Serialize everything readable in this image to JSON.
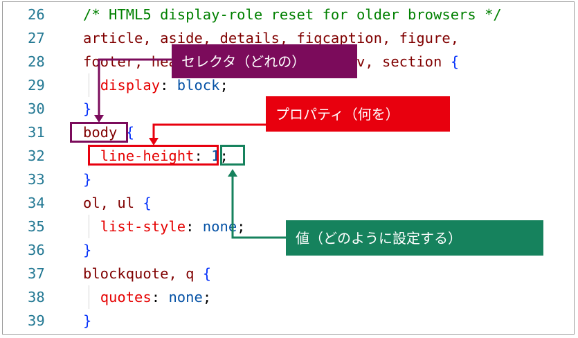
{
  "code": {
    "lines": [
      {
        "num": "26",
        "parts": [
          [
            "c-comment",
            "/* HTML5 display-role reset for older browsers */"
          ]
        ]
      },
      {
        "num": "27",
        "parts": [
          [
            "c-sel",
            "article, aside, details, figcaption, figure,"
          ]
        ]
      },
      {
        "num": "28",
        "parts": [
          [
            "c-sel",
            "footer, header, hgroup, menu, "
          ],
          [
            "c-sel",
            "nav, section "
          ],
          [
            "c-brace",
            "{"
          ]
        ]
      },
      {
        "num": "29",
        "parts": [
          [
            "c-punc",
            "  "
          ],
          [
            "c-prop",
            "display"
          ],
          [
            "c-punc",
            ": "
          ],
          [
            "c-val",
            "block"
          ],
          [
            "c-punc",
            ";"
          ]
        ]
      },
      {
        "num": "30",
        "parts": [
          [
            "c-brace",
            "}"
          ]
        ]
      },
      {
        "num": "31",
        "parts": [
          [
            "c-sel",
            "body"
          ],
          [
            "c-punc",
            " "
          ],
          [
            "c-brace",
            "{"
          ]
        ]
      },
      {
        "num": "32",
        "parts": [
          [
            "c-punc",
            "  "
          ],
          [
            "c-prop",
            "line-height"
          ],
          [
            "c-punc",
            ": "
          ],
          [
            "c-val",
            "1"
          ],
          [
            "c-punc",
            ";"
          ]
        ]
      },
      {
        "num": "33",
        "parts": [
          [
            "c-brace",
            "}"
          ]
        ]
      },
      {
        "num": "34",
        "parts": [
          [
            "c-sel",
            "ol, ul "
          ],
          [
            "c-brace",
            "{"
          ]
        ]
      },
      {
        "num": "35",
        "parts": [
          [
            "c-punc",
            "  "
          ],
          [
            "c-prop",
            "list-style"
          ],
          [
            "c-punc",
            ": "
          ],
          [
            "c-val",
            "none"
          ],
          [
            "c-punc",
            ";"
          ]
        ]
      },
      {
        "num": "36",
        "parts": [
          [
            "c-brace",
            "}"
          ]
        ]
      },
      {
        "num": "37",
        "parts": [
          [
            "c-sel",
            "blockquote, q "
          ],
          [
            "c-brace",
            "{"
          ]
        ]
      },
      {
        "num": "38",
        "parts": [
          [
            "c-punc",
            "  "
          ],
          [
            "c-prop",
            "quotes"
          ],
          [
            "c-punc",
            ": "
          ],
          [
            "c-val",
            "none"
          ],
          [
            "c-punc",
            ";"
          ]
        ]
      },
      {
        "num": "39",
        "parts": [
          [
            "c-brace",
            "}"
          ]
        ]
      }
    ]
  },
  "annotations": {
    "selector": {
      "text": "セレクタ（どれの）",
      "color": "#7b0b5b"
    },
    "property": {
      "text": "プロパティ（何を）",
      "color": "#e8000e"
    },
    "value": {
      "text": "値（どのように設定する）",
      "color": "#16825d"
    }
  }
}
